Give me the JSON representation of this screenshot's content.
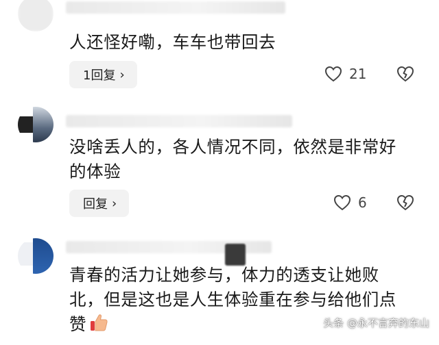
{
  "comments": [
    {
      "text": "人还怪好嘞，车车也带回去",
      "reply_label": "1回复",
      "likes": "21"
    },
    {
      "text": "没啥丢人的，各人情况不同，依然是非常好的体验",
      "reply_label": "回复",
      "likes": "6"
    },
    {
      "text": "青春的活力让她参与，体力的透支让她败北，但是这也是人生体验重在参与给他们点赞"
    }
  ],
  "icons": {
    "like": "heart-outline-icon",
    "dislike": "broken-heart-icon",
    "reply_chevron": "chevron-right-icon",
    "emoji": "thumbs-up-emoji"
  },
  "reply_chevron_glyph": "›",
  "watermark": "头条 @永不言弃的东山",
  "colors": {
    "text": "#1a1a1a",
    "reply_bg": "#f2f2f2",
    "icon": "#444444"
  }
}
